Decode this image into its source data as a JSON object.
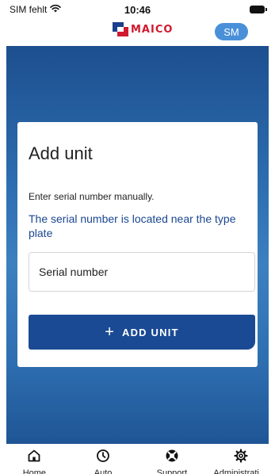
{
  "status_bar": {
    "carrier": "SIM fehlt",
    "time": "10:46"
  },
  "header": {
    "brand": "MAICO",
    "avatar_initials": "SM"
  },
  "card": {
    "title": "Add unit",
    "instruction": "Enter serial number manually.",
    "hint": "The serial number is located near the type plate",
    "serial_input": {
      "value": "",
      "placeholder": "Serial number"
    },
    "add_button_label": "ADD UNIT"
  },
  "bottom_nav": {
    "items": [
      {
        "label": "Home",
        "icon": "home-icon"
      },
      {
        "label": "Auto",
        "icon": "clock-icon"
      },
      {
        "label": "Support",
        "icon": "lifebuoy-icon"
      },
      {
        "label": "Administrati…",
        "icon": "gear-icon"
      }
    ]
  },
  "colors": {
    "brand_red": "#d0192e",
    "primary_blue": "#1a4a94",
    "hint_blue": "#1a4690",
    "avatar_blue": "#4a90d9"
  }
}
